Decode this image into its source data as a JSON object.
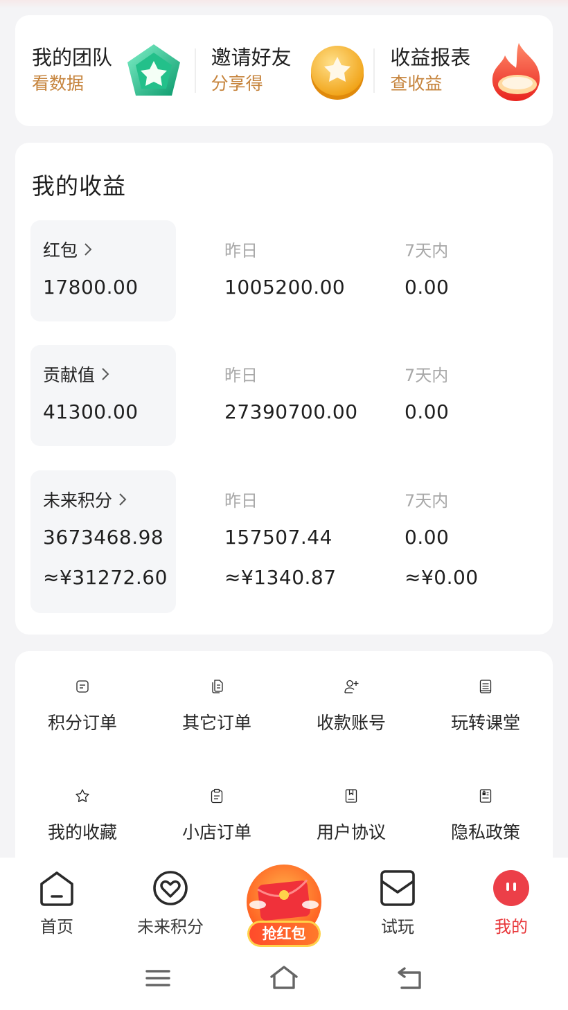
{
  "quick_entries": [
    {
      "title": "我的团队",
      "subtitle": "看数据",
      "icon": "team-gem-icon"
    },
    {
      "title": "邀请好友",
      "subtitle": "分享得",
      "icon": "invite-coin-icon"
    },
    {
      "title": "收益报表",
      "subtitle": "查收益",
      "icon": "report-flame-icon"
    }
  ],
  "earnings": {
    "title": "我的收益",
    "yesterday_label": "昨日",
    "week_label": "7天内",
    "rows": [
      {
        "label": "红包",
        "total": "17800.00",
        "yesterday": "1005200.00",
        "week": "0.00"
      },
      {
        "label": "贡献值",
        "total": "41300.00",
        "yesterday": "27390700.00",
        "week": "0.00"
      },
      {
        "label": "未来积分",
        "total": "3673468.98",
        "yesterday": "157507.44",
        "week": "0.00",
        "total_cny": "≈¥31272.60",
        "yesterday_cny": "≈¥1340.87",
        "week_cny": "≈¥0.00"
      }
    ]
  },
  "menu": [
    {
      "label": "积分订单",
      "icon": "points-order-icon"
    },
    {
      "label": "其它订单",
      "icon": "other-orders-icon"
    },
    {
      "label": "收款账号",
      "icon": "add-account-icon"
    },
    {
      "label": "玩转课堂",
      "icon": "classroom-book-icon"
    },
    {
      "label": "我的收藏",
      "icon": "star-icon"
    },
    {
      "label": "小店订单",
      "icon": "clipboard-icon"
    },
    {
      "label": "用户协议",
      "icon": "agreement-icon"
    },
    {
      "label": "隐私政策",
      "icon": "privacy-icon"
    }
  ],
  "bottom_nav": [
    {
      "label": "首页",
      "icon": "home-icon"
    },
    {
      "label": "未来积分",
      "icon": "heart-circle-icon"
    },
    {
      "label": "抢红包",
      "icon": "red-envelope-icon"
    },
    {
      "label": "试玩",
      "icon": "trial-icon"
    },
    {
      "label": "我的",
      "icon": "profile-face-icon",
      "active": true
    }
  ],
  "colors": {
    "accent": "#e8373a",
    "subtitle_gold": "#c6843d",
    "background": "#f4f4f6"
  }
}
